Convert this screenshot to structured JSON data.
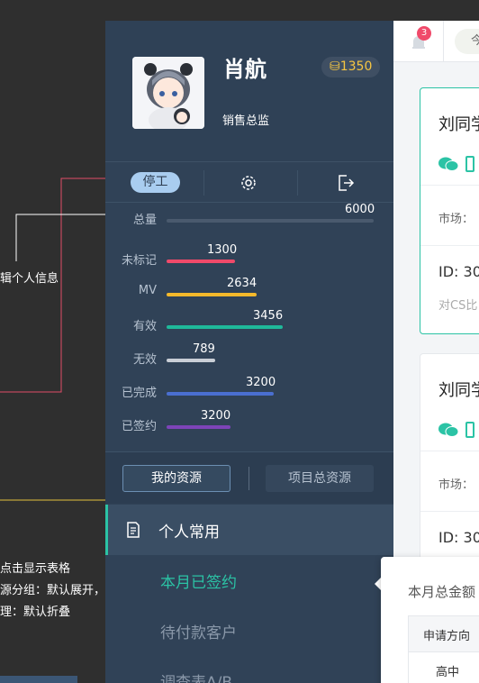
{
  "annotations": {
    "edit_profile": "辑个人信息",
    "click_table": "点击显示表格",
    "group": "源分组：默认展开，可折叠",
    "process": "理：默认折叠"
  },
  "profile": {
    "name": "肖航",
    "role": "销售总监",
    "coins": "1350",
    "coin_icon": "coin-icon"
  },
  "actions": {
    "stop_label": "停工"
  },
  "stats": [
    {
      "label": "总量",
      "value": "6000",
      "color": "#4f6179"
    },
    {
      "label": "未标记",
      "value": "1300",
      "color": "#f04a6a"
    },
    {
      "label": "MV",
      "value": "2634",
      "color": "#f5b92b"
    },
    {
      "label": "有效",
      "value": "3456",
      "color": "#1fb99a"
    },
    {
      "label": "无效",
      "value": "789",
      "color": "#c9ced6"
    },
    {
      "label": "已完成",
      "value": "3200",
      "color": "#4a6fd0"
    },
    {
      "label": "已签约",
      "value": "3200",
      "color": "#7d44b8"
    }
  ],
  "tabs": {
    "my_resources": "我的资源",
    "project_resources": "项目总资源"
  },
  "menu": {
    "section_title": "个人常用",
    "items": [
      "本月已签约",
      "待付款客户",
      "调查表A/B"
    ],
    "active_color": "#2bc3a5"
  },
  "topbar": {
    "notification_count": "3",
    "today_label": "今"
  },
  "cards": [
    {
      "title": "刘同学",
      "market": "市场：",
      "id": "ID: 30",
      "desc": "对CS比"
    },
    {
      "title": "刘同学",
      "market": "市场：",
      "id": "ID: 30"
    }
  ],
  "popup": {
    "title": "本月总金额",
    "col_header": "申请方向",
    "cell": "高中"
  }
}
